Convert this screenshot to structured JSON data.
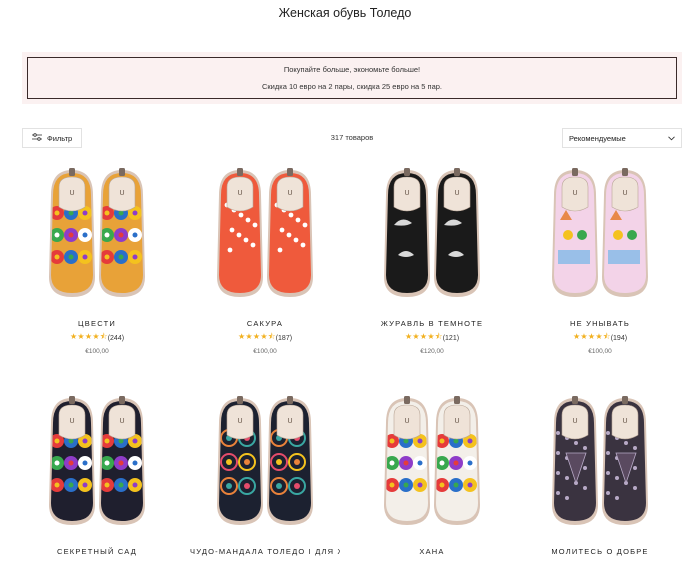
{
  "page": {
    "title": "Женская обувь Толедо"
  },
  "promo": {
    "line1": "Покупайте больше, экономьте больше!",
    "line2": "Скидка 10 евро на 2 пары, скидка 25 евро на 5 пар."
  },
  "toolbar": {
    "filter_label": "Фильтр",
    "count": "317 товаров",
    "sort_selected": "Рекомендуемые"
  },
  "products": [
    {
      "name": "ЦВЕСТИ",
      "stars": "★★★★⯪",
      "reviews": "(244)",
      "price": "€100,00",
      "upper": "#e8a238",
      "accent": "#2a6fc9",
      "pattern": "flower"
    },
    {
      "name": "САКУРА",
      "stars": "★★★★⯪",
      "reviews": "(187)",
      "price": "€100,00",
      "upper": "#ef5a3c",
      "accent": "#ffffff",
      "pattern": "sakura"
    },
    {
      "name": "ЖУРАВЛЬ В ТЕМНОТЕ",
      "stars": "★★★★⯪",
      "reviews": "(121)",
      "price": "€120,00",
      "upper": "#1a1a1a",
      "accent": "#d9d9d9",
      "pattern": "crane"
    },
    {
      "name": "НЕ УНЫВАТЬ",
      "stars": "★★★★⯪",
      "reviews": "(194)",
      "price": "€100,00",
      "upper": "#f3d3e8",
      "accent": "#5db3e8",
      "pattern": "cat"
    },
    {
      "name": "СЕКРЕТНЫЙ САД",
      "stars": "",
      "reviews": "",
      "price": "",
      "upper": "#1f1f2e",
      "accent": "#e53b3b",
      "pattern": "garden"
    },
    {
      "name": "ЧУДО-МАНДАЛА ТОЛЕДО I ДЛЯ ЖЕНЩИН",
      "stars": "",
      "reviews": "",
      "price": "",
      "upper": "#1c2130",
      "accent": "#e9823a",
      "pattern": "mandala"
    },
    {
      "name": "ХАНА",
      "stars": "",
      "reviews": "",
      "price": "",
      "upper": "#f3efe9",
      "accent": "#c9342f",
      "pattern": "hana"
    },
    {
      "name": "МОЛИТЕСЬ О ДОБРЕ",
      "stars": "",
      "reviews": "",
      "price": "",
      "upper": "#3a3340",
      "accent": "#b7a9c6",
      "pattern": "pray"
    }
  ]
}
